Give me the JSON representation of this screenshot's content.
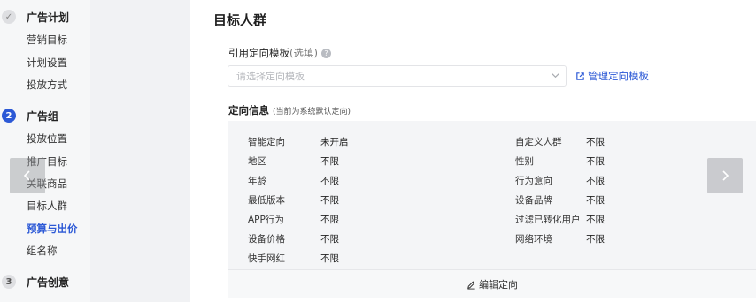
{
  "sidebar": {
    "steps": [
      {
        "badge": "✓",
        "title": "广告计划",
        "items": [
          "营销目标",
          "计划设置",
          "投放方式"
        ]
      },
      {
        "badge": "2",
        "title": "广告组",
        "items": [
          "投放位置",
          "推广目标",
          "关联商品",
          "目标人群",
          "预算与出价",
          "组名称"
        ]
      },
      {
        "badge": "3",
        "title": "广告创意",
        "items": []
      }
    ],
    "active_item": "预算与出价"
  },
  "main": {
    "title": "目标人群",
    "template": {
      "label": "引用定向模板",
      "optional": "(选填)",
      "placeholder": "请选择定向模板",
      "manage_link": "管理定向模板"
    },
    "targeting": {
      "label": "定向信息",
      "hint": "(当前为系统默认定向)",
      "left": [
        {
          "key": "智能定向",
          "value": "未开启"
        },
        {
          "key": "地区",
          "value": "不限"
        },
        {
          "key": "年龄",
          "value": "不限"
        },
        {
          "key": "最低版本",
          "value": "不限"
        },
        {
          "key": "APP行为",
          "value": "不限"
        },
        {
          "key": "设备价格",
          "value": "不限"
        },
        {
          "key": "快手网红",
          "value": "不限"
        }
      ],
      "right": [
        {
          "key": "自定义人群",
          "value": "不限"
        },
        {
          "key": "性别",
          "value": "不限"
        },
        {
          "key": "行为意向",
          "value": "不限"
        },
        {
          "key": "设备品牌",
          "value": "不限"
        },
        {
          "key": "过滤已转化用户",
          "value": "不限"
        },
        {
          "key": "网络环境",
          "value": "不限"
        }
      ],
      "edit_button": "编辑定向"
    }
  },
  "colors": {
    "accent": "#2c59d6",
    "panel": "#f4f5f7",
    "sidebar": "#f6f7f8"
  }
}
